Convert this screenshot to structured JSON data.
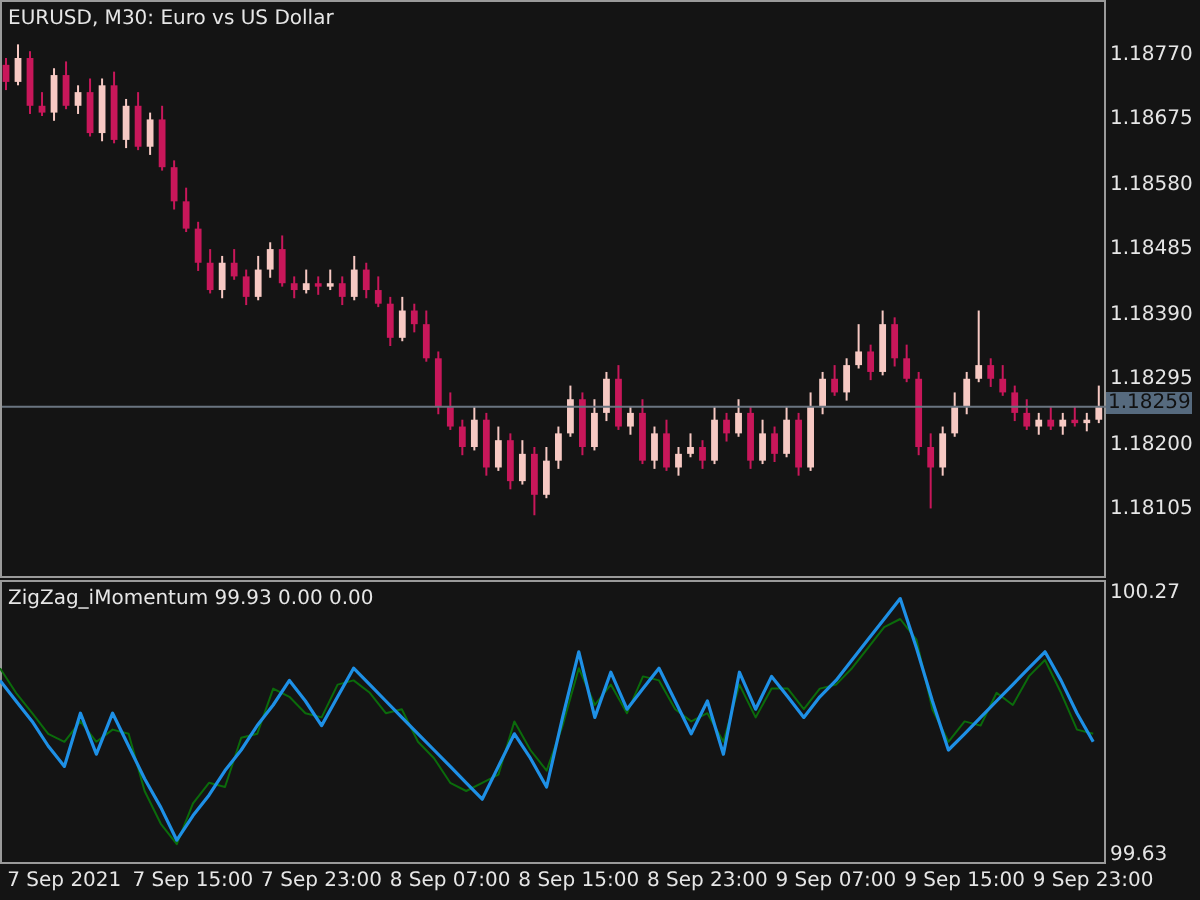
{
  "main_chart": {
    "title": "EURUSD, M30:  Euro vs US Dollar",
    "chart_data": {
      "type": "candlestick",
      "ref_lines": [
        {
          "axis": "y",
          "value": 1.18259,
          "label": "1.18259"
        }
      ],
      "categories": [
        null,
        null,
        null,
        null,
        null,
        null,
        null,
        null,
        null,
        null,
        null,
        null,
        null,
        null,
        null,
        null,
        null,
        null,
        null,
        null,
        null,
        null,
        null,
        null,
        null,
        null,
        null,
        null,
        null,
        null,
        null,
        null,
        null,
        null,
        null,
        null,
        null,
        null,
        null,
        null,
        null,
        null,
        null,
        null,
        null,
        null,
        null,
        null,
        null,
        null,
        null,
        null,
        null,
        null,
        null,
        null,
        null,
        null,
        null,
        null,
        null,
        null,
        null,
        null,
        null,
        null,
        null,
        null,
        null,
        null,
        null,
        null,
        null,
        null,
        null,
        null,
        null,
        null,
        null,
        null,
        null,
        null,
        null,
        null,
        null,
        null,
        null,
        null,
        null,
        null,
        null,
        null
      ],
      "ohlc": [
        [
          1.1876,
          1.1877,
          1.18723,
          1.18735
        ],
        [
          1.18735,
          1.1879,
          1.1873,
          1.1877
        ],
        [
          1.1877,
          1.1878,
          1.18688,
          1.187
        ],
        [
          1.187,
          1.1872,
          1.18685,
          1.1869
        ],
        [
          1.1869,
          1.18755,
          1.18678,
          1.18745
        ],
        [
          1.18745,
          1.18765,
          1.18695,
          1.187
        ],
        [
          1.187,
          1.1873,
          1.18688,
          1.1872
        ],
        [
          1.1872,
          1.1874,
          1.18655,
          1.1866
        ],
        [
          1.1866,
          1.1874,
          1.18648,
          1.1873
        ],
        [
          1.1873,
          1.1875,
          1.18645,
          1.1865
        ],
        [
          1.1865,
          1.1871,
          1.18638,
          1.187
        ],
        [
          1.187,
          1.1872,
          1.18635,
          1.1864
        ],
        [
          1.1864,
          1.1869,
          1.18628,
          1.1868
        ],
        [
          1.1868,
          1.187,
          1.18605,
          1.1861
        ],
        [
          1.1861,
          1.1862,
          1.18548,
          1.1856
        ],
        [
          1.1856,
          1.1858,
          1.18515,
          1.1852
        ],
        [
          1.1852,
          1.1853,
          1.18458,
          1.1847
        ],
        [
          1.1847,
          1.1849,
          1.18425,
          1.1843
        ],
        [
          1.1843,
          1.1848,
          1.18418,
          1.1847
        ],
        [
          1.1847,
          1.1849,
          1.18445,
          1.1845
        ],
        [
          1.1845,
          1.1846,
          1.18408,
          1.1842
        ],
        [
          1.1842,
          1.1848,
          1.18415,
          1.1846
        ],
        [
          1.1846,
          1.185,
          1.18448,
          1.1849
        ],
        [
          1.1849,
          1.1851,
          1.18435,
          1.1844
        ],
        [
          1.1844,
          1.1845,
          1.18418,
          1.1843
        ],
        [
          1.1843,
          1.1846,
          1.18425,
          1.1844
        ],
        [
          1.1844,
          1.1845,
          1.18423,
          1.18435
        ],
        [
          1.18435,
          1.1846,
          1.1843,
          1.1844
        ],
        [
          1.1844,
          1.1845,
          1.18408,
          1.1842
        ],
        [
          1.1842,
          1.1848,
          1.18415,
          1.1846
        ],
        [
          1.1846,
          1.1847,
          1.18418,
          1.1843
        ],
        [
          1.1843,
          1.1845,
          1.18405,
          1.1841
        ],
        [
          1.1841,
          1.1842,
          1.18348,
          1.1836
        ],
        [
          1.1836,
          1.1842,
          1.18355,
          1.184
        ],
        [
          1.184,
          1.1841,
          1.18368,
          1.1838
        ],
        [
          1.1838,
          1.184,
          1.18325,
          1.1833
        ],
        [
          1.1833,
          1.1834,
          1.18248,
          1.1826
        ],
        [
          1.1826,
          1.1828,
          1.18225,
          1.1823
        ],
        [
          1.1823,
          1.1824,
          1.18188,
          1.182
        ],
        [
          1.182,
          1.1826,
          1.18195,
          1.1824
        ],
        [
          1.1824,
          1.1825,
          1.18158,
          1.1817
        ],
        [
          1.1817,
          1.1823,
          1.18165,
          1.1821
        ],
        [
          1.1821,
          1.1822,
          1.18138,
          1.1815
        ],
        [
          1.1815,
          1.1821,
          1.18145,
          1.1819
        ],
        [
          1.1819,
          1.182,
          1.181,
          1.1813
        ],
        [
          1.1813,
          1.182,
          1.18125,
          1.1818
        ],
        [
          1.1818,
          1.1823,
          1.18168,
          1.1822
        ],
        [
          1.1822,
          1.1829,
          1.18215,
          1.1827
        ],
        [
          1.1827,
          1.1828,
          1.18188,
          1.182
        ],
        [
          1.182,
          1.1827,
          1.18195,
          1.1825
        ],
        [
          1.1825,
          1.1831,
          1.18238,
          1.183
        ],
        [
          1.183,
          1.1832,
          1.18225,
          1.1823
        ],
        [
          1.1823,
          1.1826,
          1.18218,
          1.1825
        ],
        [
          1.1825,
          1.1827,
          1.18175,
          1.1818
        ],
        [
          1.1818,
          1.1823,
          1.18168,
          1.1822
        ],
        [
          1.1822,
          1.1824,
          1.18165,
          1.1817
        ],
        [
          1.1817,
          1.182,
          1.18158,
          1.1819
        ],
        [
          1.1819,
          1.1822,
          1.18185,
          1.182
        ],
        [
          1.182,
          1.1821,
          1.18168,
          1.1818
        ],
        [
          1.1818,
          1.1826,
          1.18175,
          1.1824
        ],
        [
          1.1824,
          1.1825,
          1.18208,
          1.1822
        ],
        [
          1.1822,
          1.1827,
          1.18215,
          1.1825
        ],
        [
          1.1825,
          1.1826,
          1.18168,
          1.1818
        ],
        [
          1.1818,
          1.1824,
          1.18175,
          1.1822
        ],
        [
          1.1822,
          1.1823,
          1.18178,
          1.1819
        ],
        [
          1.1819,
          1.1826,
          1.18185,
          1.1824
        ],
        [
          1.1824,
          1.1825,
          1.18158,
          1.1817
        ],
        [
          1.1817,
          1.1828,
          1.18165,
          1.1826
        ],
        [
          1.1826,
          1.1831,
          1.18248,
          1.183
        ],
        [
          1.183,
          1.1832,
          1.18275,
          1.1828
        ],
        [
          1.1828,
          1.1833,
          1.18268,
          1.1832
        ],
        [
          1.1832,
          1.1838,
          1.18315,
          1.1834
        ],
        [
          1.1834,
          1.1835,
          1.18298,
          1.1831
        ],
        [
          1.1831,
          1.184,
          1.18305,
          1.1838
        ],
        [
          1.1838,
          1.1839,
          1.18318,
          1.1833
        ],
        [
          1.1833,
          1.1835,
          1.18295,
          1.183
        ],
        [
          1.183,
          1.1831,
          1.18188,
          1.182
        ],
        [
          1.182,
          1.1822,
          1.1811,
          1.1817
        ],
        [
          1.1817,
          1.1823,
          1.18158,
          1.1822
        ],
        [
          1.1822,
          1.1828,
          1.18215,
          1.1826
        ],
        [
          1.1826,
          1.1831,
          1.18248,
          1.183
        ],
        [
          1.183,
          1.184,
          1.18295,
          1.1832
        ],
        [
          1.1832,
          1.1833,
          1.18288,
          1.183
        ],
        [
          1.183,
          1.1832,
          1.18275,
          1.1828
        ],
        [
          1.1828,
          1.1829,
          1.18238,
          1.1825
        ],
        [
          1.1825,
          1.1827,
          1.18225,
          1.1823
        ],
        [
          1.1823,
          1.1825,
          1.18218,
          1.1824
        ],
        [
          1.1824,
          1.1826,
          1.18225,
          1.1823
        ],
        [
          1.1823,
          1.1825,
          1.18218,
          1.1824
        ],
        [
          1.1824,
          1.1826,
          1.1823,
          1.18235
        ],
        [
          1.18235,
          1.1825,
          1.18223,
          1.1824
        ],
        [
          1.1824,
          1.1829,
          1.18235,
          1.18259
        ]
      ],
      "ylim": [
        1.18011,
        1.18855
      ],
      "yticks": [
        {
          "value": 1.1877,
          "label": "1.18770"
        },
        {
          "value": 1.18675,
          "label": "1.18675"
        },
        {
          "value": 1.1858,
          "label": "1.18580"
        },
        {
          "value": 1.18485,
          "label": "1.18485"
        },
        {
          "value": 1.1839,
          "label": "1.18390"
        },
        {
          "value": 1.18295,
          "label": "1.18295"
        },
        {
          "value": 1.182,
          "label": "1.18200"
        },
        {
          "value": 1.18105,
          "label": "1.18105"
        }
      ]
    }
  },
  "indicator": {
    "label": "ZigZag_iMomentum 99.93 0.00 0.00",
    "chart_data": {
      "type": "line",
      "categories": [
        null,
        null,
        null,
        null,
        "7 Sep 2021",
        null,
        null,
        null,
        null,
        null,
        null,
        null,
        "7 Sep 15:00",
        null,
        null,
        null,
        null,
        null,
        null,
        null,
        "7 Sep 23:00",
        null,
        null,
        null,
        null,
        null,
        null,
        null,
        "8 Sep 07:00",
        null,
        null,
        null,
        null,
        null,
        null,
        null,
        "8 Sep 15:00",
        null,
        null,
        null,
        null,
        null,
        null,
        null,
        "8 Sep 23:00",
        null,
        null,
        null,
        null,
        null,
        null,
        null,
        "9 Sep 07:00",
        null,
        null,
        null,
        null,
        null,
        null,
        null,
        "9 Sep 15:00",
        null,
        null,
        null,
        null,
        null,
        null,
        null,
        "9 Sep 23:00"
      ],
      "series": [
        {
          "color": "#0b6b0b",
          "values": [
            100.08,
            100.02,
            99.97,
            99.92,
            99.9,
            99.95,
            99.9,
            99.93,
            99.92,
            99.78,
            99.7,
            99.65,
            99.75,
            99.8,
            99.79,
            99.91,
            99.92,
            100.03,
            100.01,
            99.97,
            99.96,
            100.04,
            100.05,
            100.02,
            99.97,
            99.98,
            99.9,
            99.86,
            99.8,
            99.78,
            99.8,
            99.82,
            99.95,
            99.88,
            99.83,
            99.94,
            100.08,
            99.99,
            100.04,
            99.97,
            100.06,
            100.05,
            99.98,
            99.95,
            99.97,
            99.9,
            100.04,
            99.96,
            100.03,
            100.03,
            99.98,
            100.03,
            100.04,
            100.08,
            100.13,
            100.18,
            100.2,
            100.15,
            99.98,
            99.9,
            99.95,
            99.94,
            100.02,
            99.99,
            100.06,
            100.1,
            100.02,
            99.93,
            99.92
          ]
        },
        {
          "color": "#1e90e6",
          "values": [
            100.05,
            100.0,
            99.95,
            99.89,
            99.84,
            99.97,
            99.87,
            99.97,
            99.89,
            99.81,
            99.74,
            99.66,
            99.72,
            99.77,
            99.83,
            99.88,
            99.94,
            99.99,
            100.05,
            100.0,
            99.94,
            100.01,
            100.08,
            100.04,
            100.0,
            99.96,
            99.92,
            99.88,
            99.84,
            99.8,
            99.76,
            99.84,
            99.92,
            99.86,
            99.79,
            99.96,
            100.12,
            99.96,
            100.07,
            99.98,
            100.03,
            100.08,
            100.0,
            99.92,
            100.0,
            99.87,
            100.07,
            99.98,
            100.06,
            100.01,
            99.96,
            100.01,
            100.05,
            100.1,
            100.15,
            100.2,
            100.25,
            100.13,
            100.0,
            99.88,
            99.92,
            99.96,
            100.0,
            100.04,
            100.08,
            100.12,
            100.05,
            99.97,
            99.9
          ]
        }
      ],
      "ylim": [
        99.6,
        100.3
      ],
      "yticks": [
        {
          "value": 100.27,
          "label": "100.27"
        },
        {
          "value": 99.63,
          "label": "99.63"
        }
      ]
    }
  }
}
